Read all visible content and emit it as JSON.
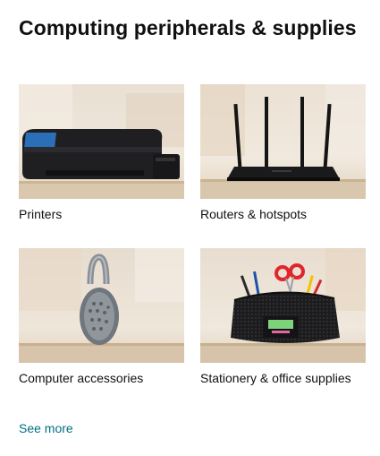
{
  "card": {
    "title": "Computing peripherals & supplies",
    "tiles": [
      {
        "label": "Printers",
        "icon": "printer-image"
      },
      {
        "label": "Routers & hotspots",
        "icon": "router-image"
      },
      {
        "label": "Computer accessories",
        "icon": "headphones-image"
      },
      {
        "label": "Stationery & office supplies",
        "icon": "desk-organizer-image"
      }
    ],
    "see_more": "See more"
  },
  "colors": {
    "title": "#0f1111",
    "link": "#007185",
    "background": "#ffffff"
  }
}
